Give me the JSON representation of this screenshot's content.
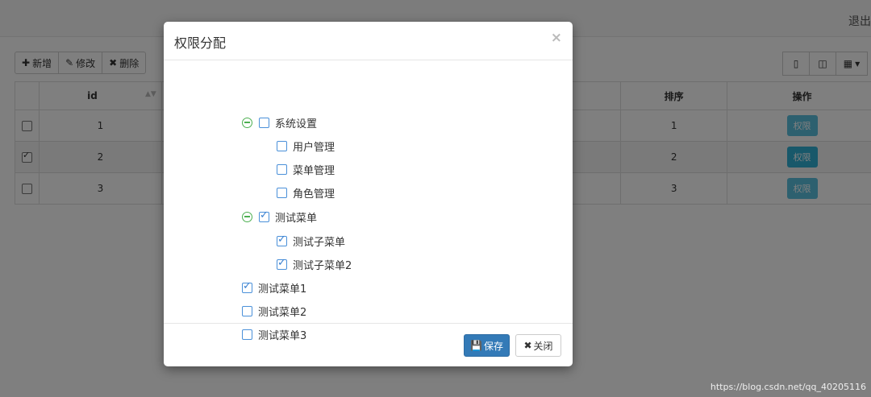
{
  "header": {
    "logout": "退出"
  },
  "toolbar": {
    "add": "新增",
    "edit": "修改",
    "delete": "删除"
  },
  "table": {
    "columns": [
      "id",
      "排序",
      "操作"
    ],
    "rows": [
      {
        "checked": false,
        "id": "1",
        "sort": "1",
        "action": "权限"
      },
      {
        "checked": true,
        "id": "2",
        "sort": "2",
        "action": "权限"
      },
      {
        "checked": false,
        "id": "3",
        "sort": "3",
        "action": "权限"
      }
    ]
  },
  "modal": {
    "title": "权限分配",
    "close_symbol": "×",
    "tree": [
      {
        "label": "系统设置",
        "checked": false
      },
      {
        "label": "用户管理",
        "checked": false
      },
      {
        "label": "菜单管理",
        "checked": false
      },
      {
        "label": "角色管理",
        "checked": false
      },
      {
        "label": "测试菜单",
        "checked": true
      },
      {
        "label": "测试子菜单",
        "checked": true
      },
      {
        "label": "测试子菜单2",
        "checked": true
      },
      {
        "label": "测试菜单1",
        "checked": true
      },
      {
        "label": "测试菜单2",
        "checked": false
      },
      {
        "label": "测试菜单3",
        "checked": false
      }
    ],
    "save": "保存",
    "cancel": "关闭"
  },
  "watermark": "https://blog.csdn.net/qq_40205116"
}
